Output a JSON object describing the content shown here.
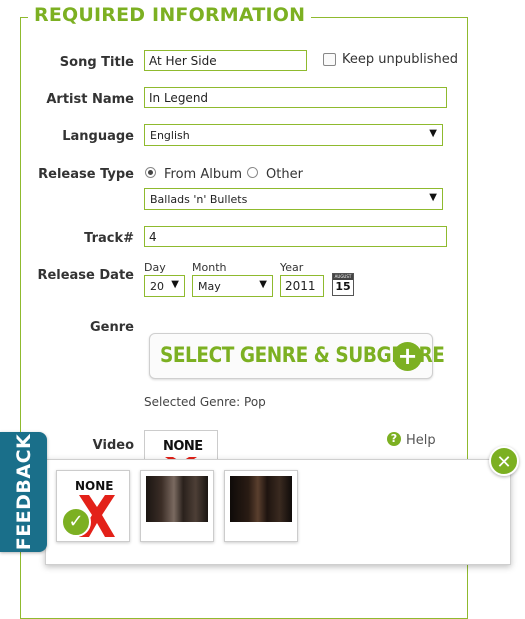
{
  "section_title": "REQUIRED INFORMATION",
  "song_title": {
    "label": "Song Title",
    "value": "At Her Side"
  },
  "keep_unpublished": {
    "label": "Keep unpublished",
    "checked": false
  },
  "artist_name": {
    "label": "Artist Name",
    "value": "In Legend"
  },
  "language": {
    "label": "Language",
    "value": "English"
  },
  "release_type": {
    "label": "Release Type",
    "option_album": "From Album",
    "option_other": "Other",
    "selected": "From Album",
    "album_value": "Ballads 'n' Bullets"
  },
  "track": {
    "label": "Track#",
    "value": "4"
  },
  "release_date": {
    "label": "Release Date",
    "day_label": "Day",
    "day_value": "20",
    "month_label": "Month",
    "month_value": "May",
    "year_label": "Year",
    "year_value": "2011",
    "calendar_month": "AUGUST",
    "calendar_day": "15"
  },
  "genre": {
    "label": "Genre",
    "button_label": "SELECT GENRE & SUBGENRE",
    "selected_text": "Selected Genre: Pop"
  },
  "video": {
    "label": "Video",
    "none_text": "NONE"
  },
  "help": {
    "label": "Help"
  },
  "feedback": {
    "label": "FEEDBACK"
  },
  "popup": {
    "none_text": "NONE"
  },
  "colors": {
    "accent_green": "#7cb022",
    "feedback_blue": "#1a6f8a"
  }
}
